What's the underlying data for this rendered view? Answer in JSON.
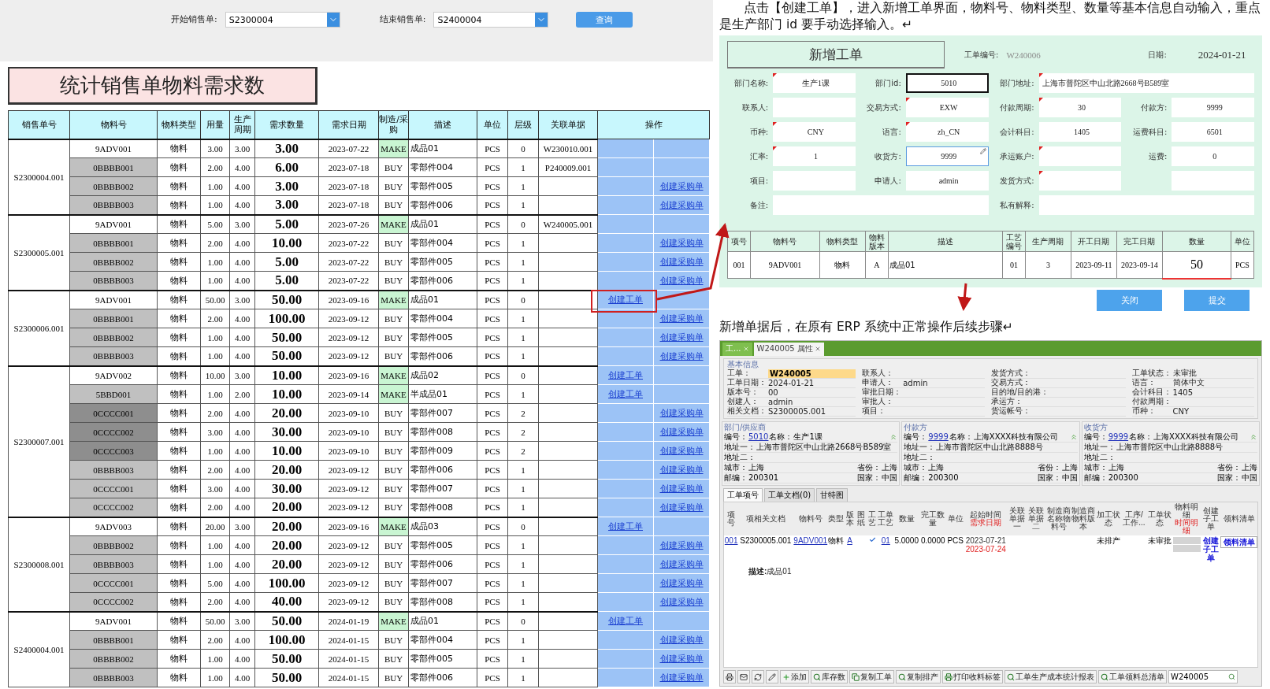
{
  "filter": {
    "start_label": "开始销售单:",
    "start_value": "S2300004",
    "end_label": "结束销售单:",
    "end_value": "S2400004",
    "query_button": "查询"
  },
  "report_title": "统计销售单物料需求数",
  "table": {
    "columns": [
      "销售单号",
      "物料号",
      "物料类型",
      "用量",
      "生产周期",
      "需求数量",
      "需求日期",
      "制造/采购",
      "描述",
      "单位",
      "层级",
      "关联单据",
      "操作"
    ],
    "groups": [
      {
        "order": "S2300004.001",
        "rows": [
          {
            "material": "9ADV001",
            "color": "#ffffff",
            "type": "物料",
            "usage": "3.00",
            "cycle": "3.00",
            "qty": "3.00",
            "date": "2023-07-22",
            "kind": "make",
            "mode": "MAKE",
            "desc": "成品01",
            "unit": "PCS",
            "level": "0",
            "ref": "W230010.001"
          },
          {
            "material": "0BBBB001",
            "color": "#c0c0c0",
            "type": "物料",
            "usage": "2.00",
            "cycle": "4.00",
            "qty": "6.00",
            "date": "2023-07-18",
            "kind": "buy",
            "mode": "BUY",
            "desc": "零部件004",
            "unit": "PCS",
            "level": "1",
            "ref": "P240009.001"
          },
          {
            "material": "0BBBB002",
            "color": "#c0c0c0",
            "type": "物料",
            "usage": "1.00",
            "cycle": "4.00",
            "qty": "3.00",
            "date": "2023-07-18",
            "kind": "buy",
            "mode": "BUY",
            "desc": "零部件005",
            "unit": "PCS",
            "level": "1",
            "purchase": "创建采购单"
          },
          {
            "material": "0BBBB003",
            "color": "#c0c0c0",
            "type": "物料",
            "usage": "1.00",
            "cycle": "4.00",
            "qty": "3.00",
            "date": "2023-07-18",
            "kind": "buy",
            "mode": "BUY",
            "desc": "零部件006",
            "unit": "PCS",
            "level": "1",
            "purchase": "创建采购单"
          }
        ]
      },
      {
        "order": "S2300005.001",
        "rows": [
          {
            "material": "9ADV001",
            "color": "#ffffff",
            "type": "物料",
            "usage": "5.00",
            "cycle": "3.00",
            "qty": "5.00",
            "date": "2023-07-26",
            "kind": "make",
            "mode": "MAKE",
            "desc": "成品01",
            "unit": "PCS",
            "level": "0",
            "ref": "W240005.001"
          },
          {
            "material": "0BBBB001",
            "color": "#c0c0c0",
            "type": "物料",
            "usage": "2.00",
            "cycle": "4.00",
            "qty": "10.00",
            "date": "2023-07-22",
            "kind": "buy",
            "mode": "BUY",
            "desc": "零部件004",
            "unit": "PCS",
            "level": "1",
            "purchase": "创建采购单"
          },
          {
            "material": "0BBBB002",
            "color": "#c0c0c0",
            "type": "物料",
            "usage": "1.00",
            "cycle": "4.00",
            "qty": "5.00",
            "date": "2023-07-22",
            "kind": "buy",
            "mode": "BUY",
            "desc": "零部件005",
            "unit": "PCS",
            "level": "1",
            "purchase": "创建采购单"
          },
          {
            "material": "0BBBB003",
            "color": "#c0c0c0",
            "type": "物料",
            "usage": "1.00",
            "cycle": "4.00",
            "qty": "5.00",
            "date": "2023-07-22",
            "kind": "buy",
            "mode": "BUY",
            "desc": "零部件006",
            "unit": "PCS",
            "level": "1",
            "purchase": "创建采购单"
          }
        ]
      },
      {
        "order": "S2300006.001",
        "rows": [
          {
            "material": "9ADV001",
            "color": "#ffffff",
            "type": "物料",
            "usage": "50.00",
            "cycle": "3.00",
            "qty": "50.00",
            "date": "2023-09-16",
            "kind": "make",
            "mode": "MAKE",
            "desc": "成品01",
            "unit": "PCS",
            "level": "0",
            "work_order": "创建工单"
          },
          {
            "material": "0BBBB001",
            "color": "#c0c0c0",
            "type": "物料",
            "usage": "2.00",
            "cycle": "4.00",
            "qty": "100.00",
            "date": "2023-09-12",
            "kind": "buy",
            "mode": "BUY",
            "desc": "零部件004",
            "unit": "PCS",
            "level": "1",
            "purchase": "创建采购单"
          },
          {
            "material": "0BBBB002",
            "color": "#c0c0c0",
            "type": "物料",
            "usage": "1.00",
            "cycle": "4.00",
            "qty": "50.00",
            "date": "2023-09-12",
            "kind": "buy",
            "mode": "BUY",
            "desc": "零部件005",
            "unit": "PCS",
            "level": "1",
            "purchase": "创建采购单"
          },
          {
            "material": "0BBBB003",
            "color": "#c0c0c0",
            "type": "物料",
            "usage": "1.00",
            "cycle": "4.00",
            "qty": "50.00",
            "date": "2023-09-12",
            "kind": "buy",
            "mode": "BUY",
            "desc": "零部件006",
            "unit": "PCS",
            "level": "1",
            "purchase": "创建采购单"
          }
        ]
      },
      {
        "order": "S2300007.001",
        "rows": [
          {
            "material": "9ADV002",
            "color": "#ffffff",
            "type": "物料",
            "usage": "10.00",
            "cycle": "3.00",
            "qty": "10.00",
            "date": "2023-09-16",
            "kind": "make",
            "mode": "MAKE",
            "desc": "成品02",
            "unit": "PCS",
            "level": "0",
            "work_order": "创建工单"
          },
          {
            "material": "5BBD001",
            "color": "#c0c0c0",
            "type": "物料",
            "usage": "1.00",
            "cycle": "2.00",
            "qty": "10.00",
            "date": "2023-09-14",
            "kind": "make",
            "mode": "MAKE",
            "desc": "半成品01",
            "unit": "PCS",
            "level": "1",
            "work_order": "创建工单"
          },
          {
            "material": "0CCCC001",
            "color": "#8e8e8e",
            "type": "物料",
            "usage": "2.00",
            "cycle": "4.00",
            "qty": "20.00",
            "date": "2023-09-10",
            "kind": "buy",
            "mode": "BUY",
            "desc": "零部件007",
            "unit": "PCS",
            "level": "2",
            "purchase": "创建采购单"
          },
          {
            "material": "0CCCC002",
            "color": "#8e8e8e",
            "type": "物料",
            "usage": "3.00",
            "cycle": "4.00",
            "qty": "30.00",
            "date": "2023-09-10",
            "kind": "buy",
            "mode": "BUY",
            "desc": "零部件008",
            "unit": "PCS",
            "level": "2",
            "purchase": "创建采购单"
          },
          {
            "material": "0CCCC003",
            "color": "#8e8e8e",
            "type": "物料",
            "usage": "1.00",
            "cycle": "4.00",
            "qty": "10.00",
            "date": "2023-09-10",
            "kind": "buy",
            "mode": "BUY",
            "desc": "零部件009",
            "unit": "PCS",
            "level": "2",
            "purchase": "创建采购单"
          },
          {
            "material": "0BBBB003",
            "color": "#c0c0c0",
            "type": "物料",
            "usage": "2.00",
            "cycle": "4.00",
            "qty": "20.00",
            "date": "2023-09-12",
            "kind": "buy",
            "mode": "BUY",
            "desc": "零部件006",
            "unit": "PCS",
            "level": "1",
            "purchase": "创建采购单"
          },
          {
            "material": "0CCCC001",
            "color": "#c0c0c0",
            "type": "物料",
            "usage": "3.00",
            "cycle": "4.00",
            "qty": "30.00",
            "date": "2023-09-12",
            "kind": "buy",
            "mode": "BUY",
            "desc": "零部件007",
            "unit": "PCS",
            "level": "1",
            "purchase": "创建采购单"
          },
          {
            "material": "0CCCC002",
            "color": "#c0c0c0",
            "type": "物料",
            "usage": "2.00",
            "cycle": "4.00",
            "qty": "20.00",
            "date": "2023-09-12",
            "kind": "buy",
            "mode": "BUY",
            "desc": "零部件008",
            "unit": "PCS",
            "level": "1",
            "purchase": "创建采购单"
          }
        ]
      },
      {
        "order": "S2300008.001",
        "rows": [
          {
            "material": "9ADV003",
            "color": "#ffffff",
            "type": "物料",
            "usage": "20.00",
            "cycle": "3.00",
            "qty": "20.00",
            "date": "2023-09-16",
            "kind": "make",
            "mode": "MAKE",
            "desc": "成品03",
            "unit": "PCS",
            "level": "0",
            "work_order": "创建工单"
          },
          {
            "material": "0BBBB002",
            "color": "#c0c0c0",
            "type": "物料",
            "usage": "1.00",
            "cycle": "4.00",
            "qty": "20.00",
            "date": "2023-09-12",
            "kind": "buy",
            "mode": "BUY",
            "desc": "零部件005",
            "unit": "PCS",
            "level": "1",
            "purchase": "创建采购单"
          },
          {
            "material": "0BBBB003",
            "color": "#c0c0c0",
            "type": "物料",
            "usage": "1.00",
            "cycle": "4.00",
            "qty": "20.00",
            "date": "2023-09-12",
            "kind": "buy",
            "mode": "BUY",
            "desc": "零部件006",
            "unit": "PCS",
            "level": "1",
            "purchase": "创建采购单"
          },
          {
            "material": "0CCCC001",
            "color": "#c0c0c0",
            "type": "物料",
            "usage": "5.00",
            "cycle": "4.00",
            "qty": "100.00",
            "date": "2023-09-12",
            "kind": "buy",
            "mode": "BUY",
            "desc": "零部件007",
            "unit": "PCS",
            "level": "1",
            "purchase": "创建采购单"
          },
          {
            "material": "0CCCC002",
            "color": "#c0c0c0",
            "type": "物料",
            "usage": "2.00",
            "cycle": "4.00",
            "qty": "40.00",
            "date": "2023-09-12",
            "kind": "buy",
            "mode": "BUY",
            "desc": "零部件008",
            "unit": "PCS",
            "level": "1",
            "purchase": "创建采购单"
          }
        ]
      },
      {
        "order": "S2400004.001",
        "rows": [
          {
            "material": "9ADV001",
            "color": "#ffffff",
            "type": "物料",
            "usage": "50.00",
            "cycle": "3.00",
            "qty": "50.00",
            "date": "2024-01-19",
            "kind": "make",
            "mode": "MAKE",
            "desc": "成品01",
            "unit": "PCS",
            "level": "0",
            "work_order": "创建工单"
          },
          {
            "material": "0BBBB001",
            "color": "#c0c0c0",
            "type": "物料",
            "usage": "2.00",
            "cycle": "4.00",
            "qty": "100.00",
            "date": "2024-01-15",
            "kind": "buy",
            "mode": "BUY",
            "desc": "零部件004",
            "unit": "PCS",
            "level": "1",
            "purchase": "创建采购单"
          },
          {
            "material": "0BBBB002",
            "color": "#c0c0c0",
            "type": "物料",
            "usage": "1.00",
            "cycle": "4.00",
            "qty": "50.00",
            "date": "2024-01-15",
            "kind": "buy",
            "mode": "BUY",
            "desc": "零部件005",
            "unit": "PCS",
            "level": "1",
            "purchase": "创建采购单"
          },
          {
            "material": "0BBBB003",
            "color": "#c0c0c0",
            "type": "物料",
            "usage": "1.00",
            "cycle": "4.00",
            "qty": "50.00",
            "date": "2024-01-15",
            "kind": "buy",
            "mode": "BUY",
            "desc": "零部件006",
            "unit": "PCS",
            "level": "1",
            "purchase": "创建采购单"
          }
        ]
      }
    ]
  },
  "intro": "点击【创建工单】，进入新增工单界面，物料号、物料类型、数量等基本信息自动输入，重点是生产部门 id 要手动选择输入。↵",
  "form": {
    "title": "新增工单",
    "number_label": "工单编号:",
    "number_value": "W240006",
    "date_label": "日期:",
    "date_value": "2024-01-21",
    "fields": [
      {
        "label": "部门名称:",
        "value": "生产1课",
        "required": true,
        "kind": "plain"
      },
      {
        "label": "部门id:",
        "value": "5010",
        "required": false,
        "kind": "current"
      },
      {
        "label": "部门地址:",
        "value": "上海市普陀区中山北路2668号B589室",
        "required": true,
        "kind": "wide"
      },
      {
        "label": "联系人:",
        "required": false,
        "kind": "plain"
      },
      {
        "label": "交易方式:",
        "value": "EXW",
        "required": true,
        "kind": "plain"
      },
      {
        "label": "付款周期:",
        "value": "30",
        "required": true,
        "kind": "plain"
      },
      {
        "label": "付款方:",
        "value": "9999",
        "required": false,
        "kind": "plain"
      },
      {
        "label": "币种:",
        "value": "CNY",
        "required": true,
        "kind": "plain"
      },
      {
        "label": "语言:",
        "value": "zh_CN",
        "required": true,
        "kind": "plain"
      },
      {
        "label": "会计科目:",
        "value": "1405",
        "required": false,
        "kind": "plain"
      },
      {
        "label": "运费科目:",
        "value": "6501",
        "required": false,
        "kind": "plain"
      },
      {
        "label": "汇率:",
        "value": "1",
        "required": true,
        "kind": "plain"
      },
      {
        "label": "收货方:",
        "value": "9999",
        "required": false,
        "kind": "editing"
      },
      {
        "label": "承运账户:",
        "required": true,
        "kind": "plain"
      },
      {
        "label": "运费:",
        "value": "0",
        "required": false,
        "kind": "plain"
      },
      {
        "label": "项目:",
        "required": false,
        "kind": "plain"
      },
      {
        "label": "申请人:",
        "value": "admin",
        "required": false,
        "kind": "plain"
      },
      {
        "label": "发货方式:",
        "required": true,
        "kind": "plain"
      },
      {
        "required": false,
        "kind": "plain"
      },
      {
        "label": "备注:",
        "required": false,
        "kind": "wide"
      },
      {
        "label": "私有解释:",
        "required": false,
        "kind": "wide"
      }
    ],
    "item_columns": [
      "项号",
      "物料号",
      "物料类型",
      "物料版本",
      "描述",
      "工艺编号",
      "生产周期",
      "开工日期",
      "完工日期",
      "数量",
      "单位"
    ],
    "item_rows": [
      [
        "001",
        "9ADV001",
        "物料",
        "A",
        "成品01",
        "01",
        "3",
        "2023-09-11",
        "2023-09-14",
        "50",
        "PCS"
      ]
    ],
    "buttons": [
      "关闭",
      "提交"
    ]
  },
  "followup": "新增单据后，在原有 ERP 系统中正常操作后续步骤↵",
  "erp": {
    "tabs": [
      {
        "label": "工...",
        "selected": false
      },
      {
        "label": "W240005 属性",
        "selected": true
      }
    ],
    "basic_info": {
      "title": "基本信息",
      "key_field": {
        "label": "工单：",
        "value": "W240005"
      },
      "columns": [
        [
          {
            "label": "工单日期：",
            "value": "2024-01-21"
          },
          {
            "label": "版本号：",
            "value": "00"
          },
          {
            "label": "创建人：",
            "value": "admin"
          },
          {
            "label": "相关文档：",
            "value": "S2300005.001"
          }
        ],
        [
          {
            "label": "联系人："
          },
          {
            "label": "申请人：",
            "value": "admin"
          },
          {
            "label": "审批日期："
          },
          {
            "label": "审批人："
          },
          {
            "label": "项目："
          }
        ],
        [
          {
            "label": "发货方式："
          },
          {
            "label": "交易方式："
          },
          {
            "label": "目的地/目的港："
          },
          {
            "label": "承运方："
          },
          {
            "label": "货运帐号："
          }
        ],
        [
          {
            "label": "工单状态：",
            "value": "未审批"
          },
          {
            "label": "语言：",
            "value": "简体中文"
          },
          {
            "label": "会计科目：",
            "value": "1405"
          },
          {
            "label": "付款周期："
          },
          {
            "label": "币种：",
            "value": "CNY"
          }
        ]
      ]
    },
    "parties": [
      {
        "title": "部门/供应商",
        "code_label": "编号：",
        "code": "5010",
        "name_label": "名称：",
        "name": "生产1课",
        "address1_label": "地址一：",
        "address1": "上海市普陀区中山北路2668号B589室",
        "address2_label": "地址二：",
        "city_label": "城市：",
        "city": "上海",
        "province_label": "省份：",
        "province": "上海",
        "zip_label": "邮编：",
        "zip": "200301",
        "country_label": "国家：",
        "country": "中国"
      },
      {
        "title": "付款方",
        "code_label": "编号：",
        "code": "9999",
        "name_label": "名称：",
        "name": "上海XXXX科技有限公司",
        "address1_label": "地址一：",
        "address1": "上海市普陀区中山北路8888号",
        "address2_label": "地址二：",
        "city_label": "城市：",
        "city": "上海",
        "province_label": "省份：",
        "province": "上海",
        "zip_label": "邮编：",
        "zip": "200300",
        "country_label": "国家：",
        "country": "中国"
      },
      {
        "title": "收货方",
        "code_label": "编号：",
        "code": "9999",
        "name_label": "名称：",
        "name": "上海XXXX科技有限公司",
        "address1_label": "地址一：",
        "address1": "上海市普陀区中山北路8888号",
        "address2_label": "地址二：",
        "city_label": "城市：",
        "city": "上海",
        "province_label": "省份：",
        "province": "上海",
        "zip_label": "邮编：",
        "zip": "200300",
        "country_label": "国家：",
        "country": "中国"
      }
    ],
    "detail_tabs": [
      {
        "label": "工单项号",
        "selected": true
      },
      {
        "label": "工单文档(0)",
        "selected": false
      },
      {
        "label": "甘特图",
        "selected": false
      }
    ],
    "grid_columns": [
      {
        "label": "项号"
      },
      {
        "label": "项相关文档"
      },
      {
        "label": "物料号"
      },
      {
        "label": "类型"
      },
      {
        "label": "版本"
      },
      {
        "label": "图纸"
      },
      {
        "label": "工艺"
      },
      {
        "label": "工单工艺"
      },
      {
        "label": "数量"
      },
      {
        "label": "完工数量"
      },
      {
        "label": "单位"
      },
      {
        "label": "起始时间",
        "sub": "需求日期"
      },
      {
        "label": "关联单据一"
      },
      {
        "label": "关联单据二"
      },
      {
        "label": "制造商名称物料号"
      },
      {
        "label": "制造商物料版本"
      },
      {
        "label": "加工状态"
      },
      {
        "label": "工序/工作..."
      },
      {
        "label": "工单状态"
      },
      {
        "label": "物料明细",
        "sub": "时间明细"
      },
      {
        "label": "创建子工单"
      },
      {
        "label": "领料清单"
      }
    ],
    "grid_rows": [
      {
        "cells": [
          {
            "kind": "link",
            "text": "001"
          },
          {
            "kind": "plain",
            "text": "S2300005.001"
          },
          {
            "kind": "link",
            "text": "9ADV001"
          },
          {
            "kind": "plain",
            "text": "物料"
          },
          {
            "kind": "link",
            "text": "A"
          },
          {
            "kind": "empty"
          },
          {
            "kind": "check",
            "checked": true
          },
          {
            "kind": "link",
            "text": "01"
          },
          {
            "kind": "plain",
            "text": "5.0000"
          },
          {
            "kind": "plain",
            "text": "0.0000"
          },
          {
            "kind": "plain",
            "text": "PCS"
          },
          {
            "kind": "dates",
            "text": "2023-07-21",
            "sub": "2023-07-24"
          },
          {
            "kind": "empty"
          },
          {
            "kind": "empty"
          },
          {
            "kind": "empty"
          },
          {
            "kind": "empty"
          },
          {
            "kind": "plain",
            "text": "未排产"
          },
          {
            "kind": "empty"
          },
          {
            "kind": "plain",
            "text": "未审批"
          },
          {
            "kind": "greyed"
          },
          {
            "kind": "action",
            "text": "创建子工单"
          },
          {
            "kind": "boxed",
            "text": "领料清单"
          }
        ],
        "description": "**描述:**成品01"
      }
    ],
    "toolbar": [
      {
        "kind": "add",
        "label": "添加"
      },
      {
        "kind": "search",
        "label": "库存数"
      },
      {
        "kind": "copy",
        "label": "复制工单"
      },
      {
        "kind": "search",
        "label": "复制排产"
      },
      {
        "kind": "print",
        "label": "打印收料标签"
      },
      {
        "kind": "search",
        "label": "工单生产成本统计报表"
      },
      {
        "kind": "search",
        "label": "工单领料总清单"
      }
    ],
    "search_value": "W240005"
  }
}
